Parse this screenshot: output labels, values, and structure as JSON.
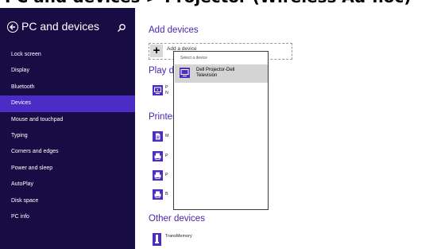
{
  "page_heading": "PC and devices > Projector (Wireless Ad-hoc)",
  "sidebar": {
    "title": "PC and devices",
    "items": [
      {
        "label": "Lock screen",
        "active": false
      },
      {
        "label": "Display",
        "active": false
      },
      {
        "label": "Bluetooth",
        "active": false
      },
      {
        "label": "Devices",
        "active": true
      },
      {
        "label": "Mouse and touchpad",
        "active": false
      },
      {
        "label": "Typing",
        "active": false
      },
      {
        "label": "Corners and edges",
        "active": false
      },
      {
        "label": "Power and sleep",
        "active": false
      },
      {
        "label": "AutoPlay",
        "active": false
      },
      {
        "label": "Disk space",
        "active": false
      },
      {
        "label": "PC info",
        "active": false
      }
    ]
  },
  "main": {
    "add_devices": {
      "heading": "Add devices",
      "button_label": "Add a device"
    },
    "play_devices": {
      "heading": "Play devices",
      "items": [
        {
          "line1": "P",
          "line2": "N"
        }
      ]
    },
    "printers": {
      "heading": "Printers",
      "items": [
        "M",
        "P",
        "P",
        "B"
      ]
    },
    "other_devices": {
      "heading": "Other devices",
      "items": [
        "TransMemory"
      ]
    }
  },
  "popup": {
    "title": "Select a device",
    "items": [
      {
        "label_line1": "Dell Projector-Dell",
        "label_line2": "Television"
      }
    ]
  },
  "colors": {
    "sidebar_bg": "#180c45",
    "sidebar_active": "#4b2cc4",
    "accent_text": "#4a25aa",
    "icon_bg": "#4b2cc4"
  }
}
